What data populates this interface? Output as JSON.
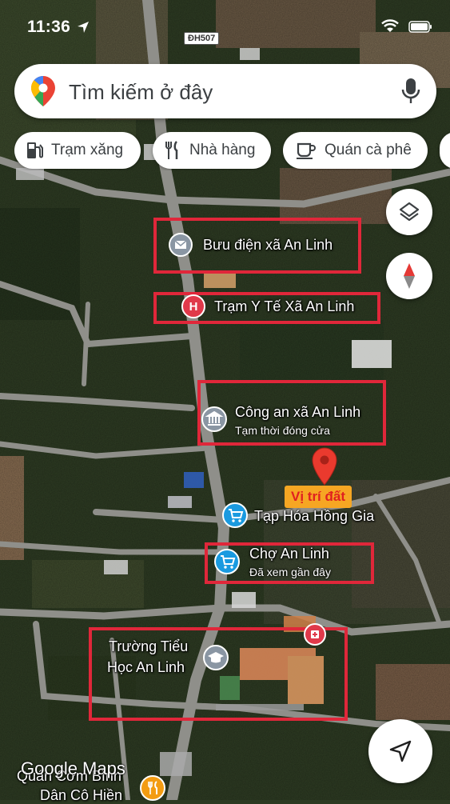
{
  "status_bar": {
    "time": "11:36"
  },
  "search": {
    "placeholder": "Tìm kiếm ở đây"
  },
  "chips": [
    {
      "label": "Trạm xăng",
      "icon": "gas-station-icon"
    },
    {
      "label": "Nhà hàng",
      "icon": "restaurant-icon"
    },
    {
      "label": "Quán cà phê",
      "icon": "coffee-icon"
    }
  ],
  "road_label": "ĐH507",
  "places": {
    "post_office": {
      "name": "Bưu điện xã An Linh",
      "icon": "post-office-icon"
    },
    "clinic": {
      "name": "Trạm Y Tế Xã An Linh",
      "icon": "hospital-icon"
    },
    "police": {
      "name": "Công an xã An Linh",
      "status": "Tạm thời đóng cửa",
      "icon": "police-building-icon"
    },
    "grocery": {
      "name": "Tạp Hóa Hồng Gia",
      "icon": "shopping-cart-icon"
    },
    "market": {
      "name": "Chợ An Linh",
      "status": "Đã xem gần đây",
      "icon": "shopping-cart-icon"
    },
    "school": {
      "name_line1": "Trường Tiểu",
      "name_line2": "Học An Linh",
      "icon": "school-icon"
    },
    "restaurant": {
      "name_line1": "Quán Cơm Bình",
      "name_line2": "Dân Cô Hiền",
      "icon": "restaurant-icon"
    }
  },
  "callout": {
    "label": "Vị trí đất"
  },
  "attribution": "Google Maps",
  "colors": {
    "highlight": "#e0273a",
    "callout_bg": "#f6a623",
    "callout_text": "#e02020",
    "poi_blue": "#1a9ae0",
    "poi_red": "#e0394a",
    "poi_gray": "#8a96a3",
    "pin_red": "#ea3a2e"
  }
}
